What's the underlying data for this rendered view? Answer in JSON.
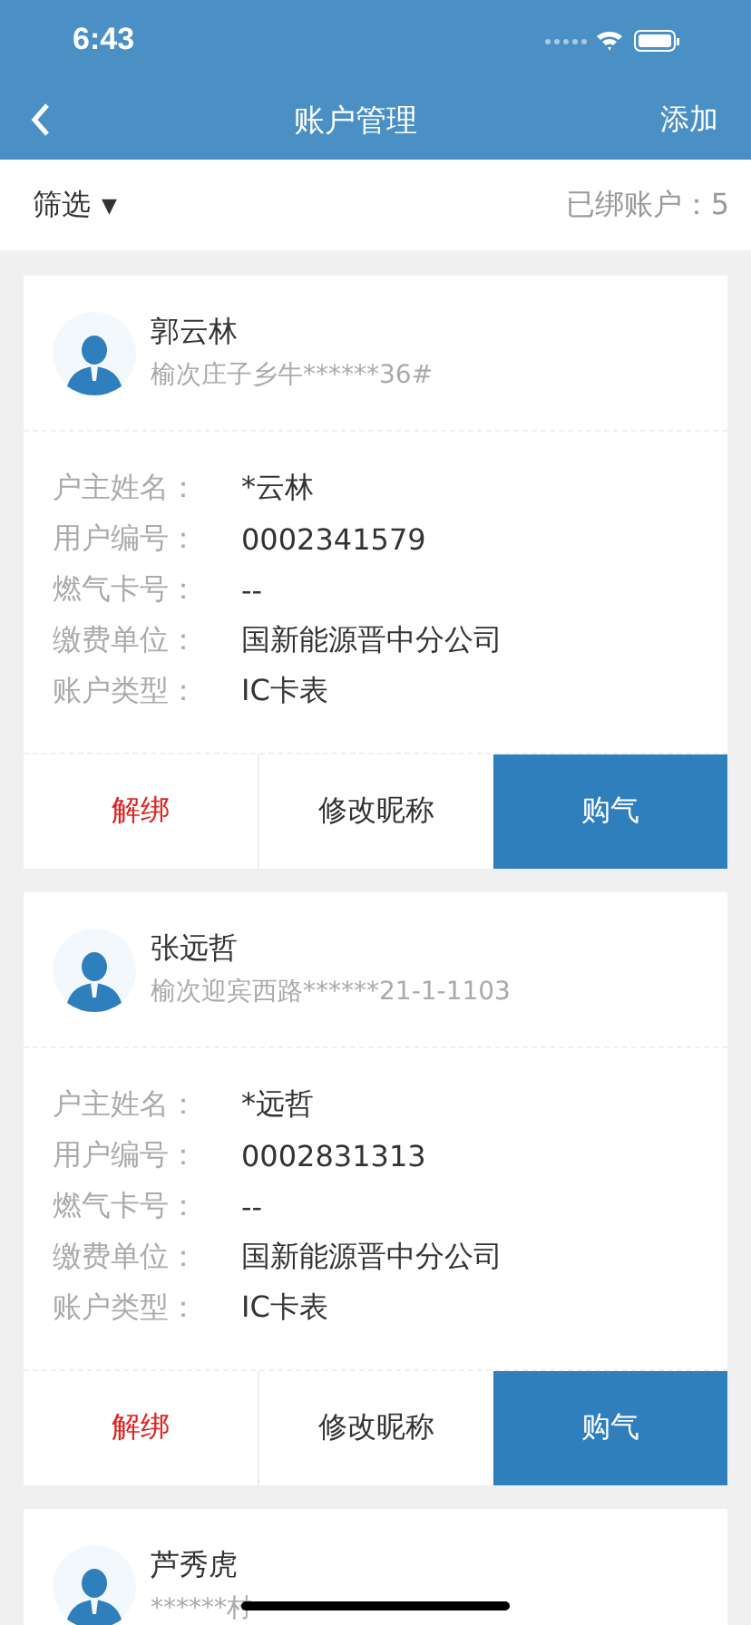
{
  "status_bar": {
    "time": "6:43"
  },
  "nav": {
    "title": "账户管理",
    "action": "添加"
  },
  "filter": {
    "label": "筛选",
    "caret": "▼",
    "count": "已绑账户：5"
  },
  "accounts": [
    {
      "name": "郭云林",
      "address": "榆次庄子乡牛******36#",
      "fields": [
        {
          "label": "户主姓名：",
          "value": "*云林"
        },
        {
          "label": "用户编号：",
          "value": "0002341579"
        },
        {
          "label": "燃气卡号：",
          "value": "--"
        },
        {
          "label": "缴费单位：",
          "value": "国新能源晋中分公司"
        },
        {
          "label": "账户类型：",
          "value": "IC卡表"
        }
      ],
      "actions": [
        {
          "kind": "danger",
          "label": "解绑"
        },
        {
          "kind": "plain",
          "label": "修改昵称"
        },
        {
          "kind": "primary",
          "label": "购气"
        }
      ]
    },
    {
      "name": "张远哲",
      "address": "榆次迎宾西路******21-1-1103",
      "fields": [
        {
          "label": "户主姓名：",
          "value": "*远哲"
        },
        {
          "label": "用户编号：",
          "value": "0002831313"
        },
        {
          "label": "燃气卡号：",
          "value": "--"
        },
        {
          "label": "缴费单位：",
          "value": "国新能源晋中分公司"
        },
        {
          "label": "账户类型：",
          "value": "IC卡表"
        }
      ],
      "actions": [
        {
          "kind": "danger",
          "label": "解绑"
        },
        {
          "kind": "plain",
          "label": "修改昵称"
        },
        {
          "kind": "primary",
          "label": "购气"
        }
      ]
    },
    {
      "name": "芦秀虎",
      "address": "******村"
    }
  ]
}
